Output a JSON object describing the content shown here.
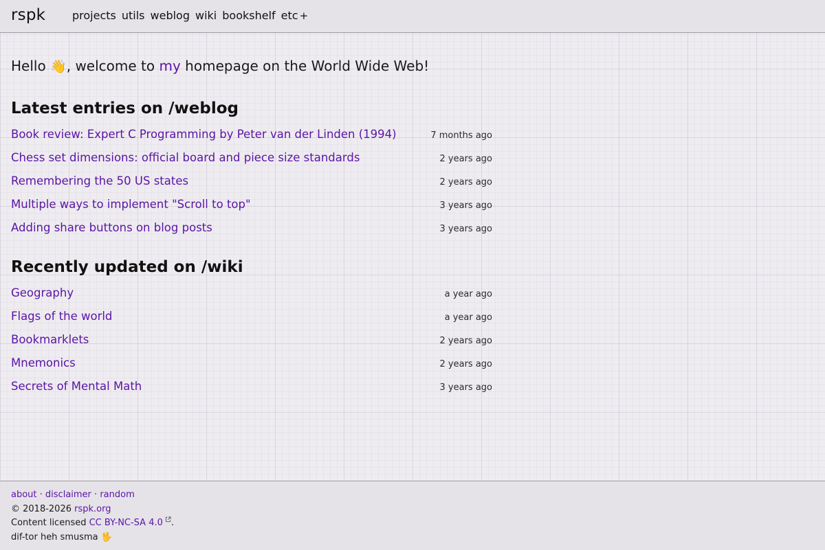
{
  "header": {
    "brand": "rspk",
    "nav": [
      {
        "label": "projects"
      },
      {
        "label": "utils"
      },
      {
        "label": "weblog"
      },
      {
        "label": "wiki"
      },
      {
        "label": "bookshelf"
      },
      {
        "label": "etc",
        "suffix": "+"
      }
    ]
  },
  "greeting": {
    "before": "Hello ",
    "emoji": "👋",
    "middle": ", welcome to ",
    "link": "my",
    "after": " homepage on the World Wide Web!"
  },
  "weblog": {
    "heading": "Latest entries on /weblog",
    "entries": [
      {
        "title": "Book review: Expert C Programming by Peter van der Linden (1994)",
        "ago": "7 months ago"
      },
      {
        "title": "Chess set dimensions: official board and piece size standards",
        "ago": "2 years ago"
      },
      {
        "title": "Remembering the 50 US states",
        "ago": "2 years ago"
      },
      {
        "title": "Multiple ways to implement \"Scroll to top\"",
        "ago": "3 years ago"
      },
      {
        "title": "Adding share buttons on blog posts",
        "ago": "3 years ago"
      }
    ]
  },
  "wiki": {
    "heading": "Recently updated on /wiki",
    "entries": [
      {
        "title": "Geography",
        "ago": "a year ago"
      },
      {
        "title": "Flags of the world",
        "ago": "a year ago"
      },
      {
        "title": "Bookmarklets",
        "ago": "2 years ago"
      },
      {
        "title": "Mnemonics",
        "ago": "2 years ago"
      },
      {
        "title": "Secrets of Mental Math",
        "ago": "3 years ago"
      }
    ]
  },
  "footer": {
    "links": [
      "about",
      "disclaimer",
      "random"
    ],
    "separator": " · ",
    "copyright": "© 2018-2026 ",
    "site_link": "rspk.org",
    "license_prefix": "Content licensed ",
    "license_link": "CC BY-NC-SA 4.0",
    "license_suffix": ".",
    "tagline": "dif-tor heh smusma ",
    "tagline_emoji": "🖖"
  },
  "colors": {
    "link": "#5b14a6",
    "text": "#1a1a1a",
    "background": "#eeecf0",
    "bar": "#e5e3e8"
  }
}
